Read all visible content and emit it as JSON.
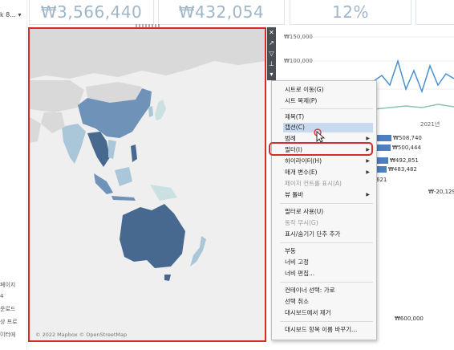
{
  "kpis": [
    {
      "value": "₩3,566,440"
    },
    {
      "value": "₩432,054"
    },
    {
      "value": "12%"
    }
  ],
  "left_panel": {
    "dropdown_text": "k 8...",
    "items": [
      "페이지",
      "4",
      "운로드",
      "상 프로",
      "이터에"
    ]
  },
  "map": {
    "attribution": "© 2022 Mapbox © OpenStreetMap",
    "region_fills": {
      "high": "#47698f",
      "mid": "#6f93b8",
      "low": "#a9c7d8",
      "lowest": "#cbe0e0",
      "land": "#d9d9d9",
      "water": "#efefef"
    }
  },
  "map_toolbar": {
    "icons": [
      "close-icon",
      "popout-icon",
      "filter-icon",
      "pin-icon",
      "more-icon"
    ]
  },
  "line_chart": {
    "y_labels": [
      "₩150,000",
      "₩100,000"
    ],
    "x_label": "2021년",
    "series_colors": [
      "#4a90d0",
      "#8cc5a8"
    ]
  },
  "bar_chart": {
    "values": [
      "₩508,740",
      "₩500,444",
      "₩492,851",
      "₩483,482"
    ],
    "partial_label": "621",
    "negative_label": "₩-20,129",
    "axis_label": "₩600,000",
    "axis_fragment": "0"
  },
  "context_menu": {
    "items": [
      {
        "label": "시트로 이동(G)"
      },
      {
        "label": "시트 복제(P)"
      },
      {
        "label": "제목(T)"
      },
      {
        "label": "캡션(C)",
        "highlighted": true
      },
      {
        "label": "범례",
        "submenu": true
      },
      {
        "label": "필터(I)",
        "submenu": true,
        "outlined": true
      },
      {
        "label": "하이라이터(H)",
        "submenu": true
      },
      {
        "label": "매개 변수(E)",
        "submenu": true
      },
      {
        "label": "페이지 컨트롤 표시(A)",
        "disabled": true
      },
      {
        "label": "뷰 툴바",
        "submenu": true
      },
      {
        "label": "필터로 사용(U)"
      },
      {
        "label": "동작 무시(G)",
        "disabled": true
      },
      {
        "label": "표시/숨기기 단추 추가"
      },
      {
        "label": "부동"
      },
      {
        "label": "너비 고정"
      },
      {
        "label": "너비 편집..."
      },
      {
        "label": "컨테이너 선택: 가로"
      },
      {
        "label": "선택 취소"
      },
      {
        "label": "대시보드에서 제거"
      },
      {
        "label": "대시보드 항목 이름 바꾸기..."
      }
    ]
  }
}
